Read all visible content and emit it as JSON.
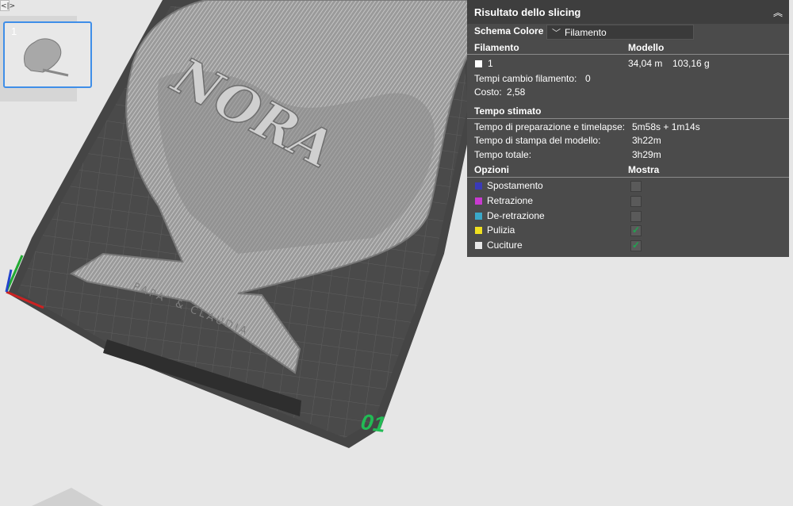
{
  "viewport": {
    "toggle_label": "<|>",
    "plate_thumbnail_number": "1",
    "plate_number": "01",
    "model_text": "NORA",
    "base_text": "PAPA' & CLAUDIA"
  },
  "panel": {
    "title": "Risultato dello slicing",
    "color_scheme_label": "Schema Colore",
    "color_scheme_value": "Filamento",
    "filament_header": "Filamento",
    "model_header": "Modello",
    "filament_id": "1",
    "filament_length": "34,04 m",
    "filament_weight": "103,16 g",
    "filament_swatch": "#ffffff",
    "changes_label": "Tempi cambio filamento:",
    "changes_value": "0",
    "cost_label": "Costo:",
    "cost_value": "2,58",
    "time_header": "Tempo stimato",
    "prep_label": "Tempo di preparazione e timelapse:",
    "prep_value": "5m58s + 1m14s",
    "print_label": "Tempo di stampa del modello:",
    "print_value": "3h22m",
    "total_label": "Tempo totale:",
    "total_value": "3h29m",
    "options_header": "Opzioni",
    "show_header": "Mostra",
    "options": [
      {
        "label": "Spostamento",
        "color": "#3a3ab8",
        "checked": false
      },
      {
        "label": "Retrazione",
        "color": "#c83ad0",
        "checked": false
      },
      {
        "label": "De-retrazione",
        "color": "#3aa8c8",
        "checked": false
      },
      {
        "label": "Pulizia",
        "color": "#f0e020",
        "checked": true
      },
      {
        "label": "Cuciture",
        "color": "#e8e8e8",
        "checked": true
      }
    ]
  }
}
